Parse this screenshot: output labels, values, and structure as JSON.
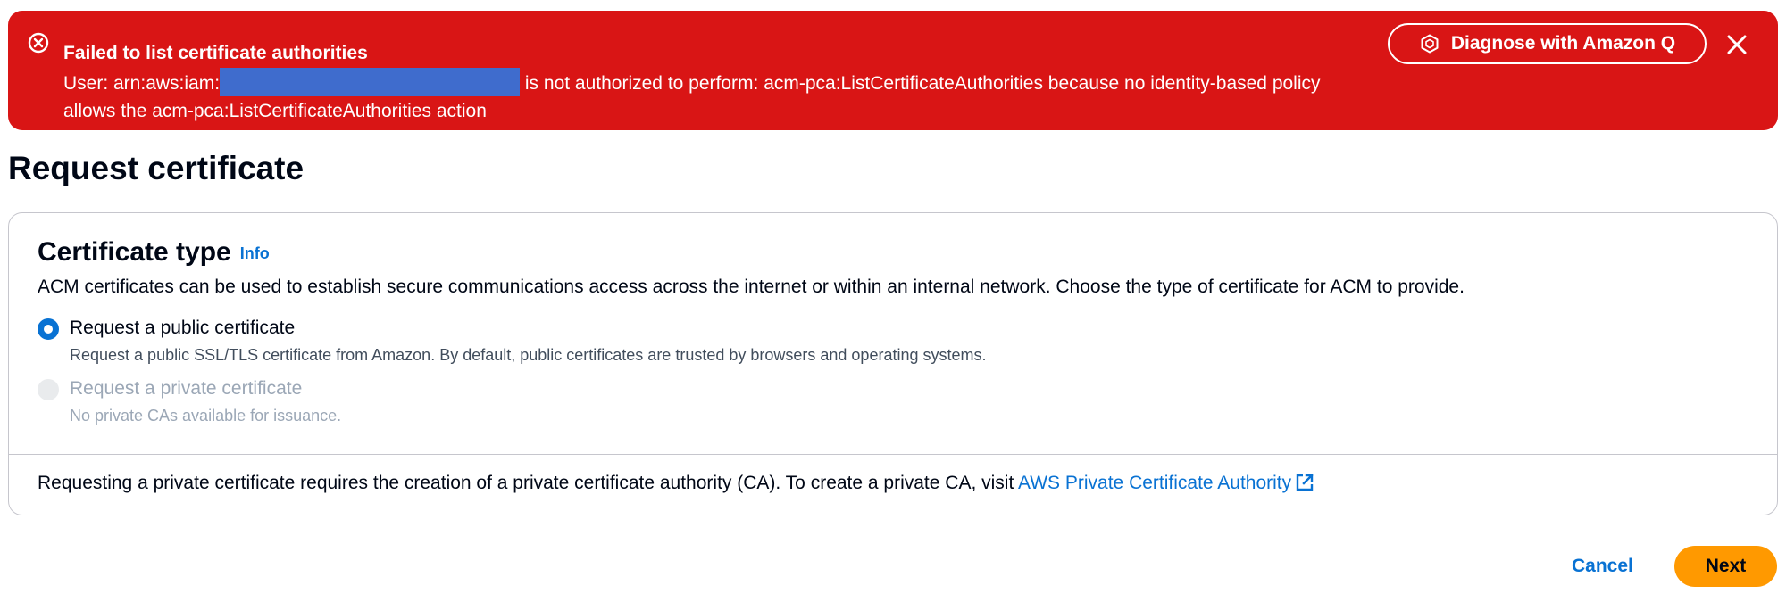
{
  "flash": {
    "title": "Failed to list certificate authorities",
    "message_prefix": "User: arn:aws:iam:",
    "message_suffix": "is not authorized to perform: acm-pca:ListCertificateAuthorities because no identity-based policy allows the acm-pca:ListCertificateAuthorities action",
    "diagnose_label": "Diagnose with Amazon Q",
    "status_color": "#d91515"
  },
  "page": {
    "title": "Request certificate"
  },
  "certificate_type": {
    "title": "Certificate type",
    "info_label": "Info",
    "description": "ACM certificates can be used to establish secure communications access across the internet or within an internal network. Choose the type of certificate for ACM to provide.",
    "options": [
      {
        "label": "Request a public certificate",
        "description": "Request a public SSL/TLS certificate from Amazon. By default, public certificates are trusted by browsers and operating systems.",
        "selected": true,
        "disabled": false
      },
      {
        "label": "Request a private certificate",
        "description": "No private CAs available for issuance.",
        "selected": false,
        "disabled": true
      }
    ],
    "footer_text": "Requesting a private certificate requires the creation of a private certificate authority (CA). To create a private CA, visit",
    "footer_link": "AWS Private Certificate Authority"
  },
  "actions": {
    "cancel_label": "Cancel",
    "next_label": "Next",
    "primary_color": "#ff9900",
    "link_color": "#0972d3"
  },
  "icons": {
    "error": "error-circle-icon",
    "amazon_q": "amazon-q-icon",
    "close": "close-icon",
    "external": "external-link-icon"
  }
}
